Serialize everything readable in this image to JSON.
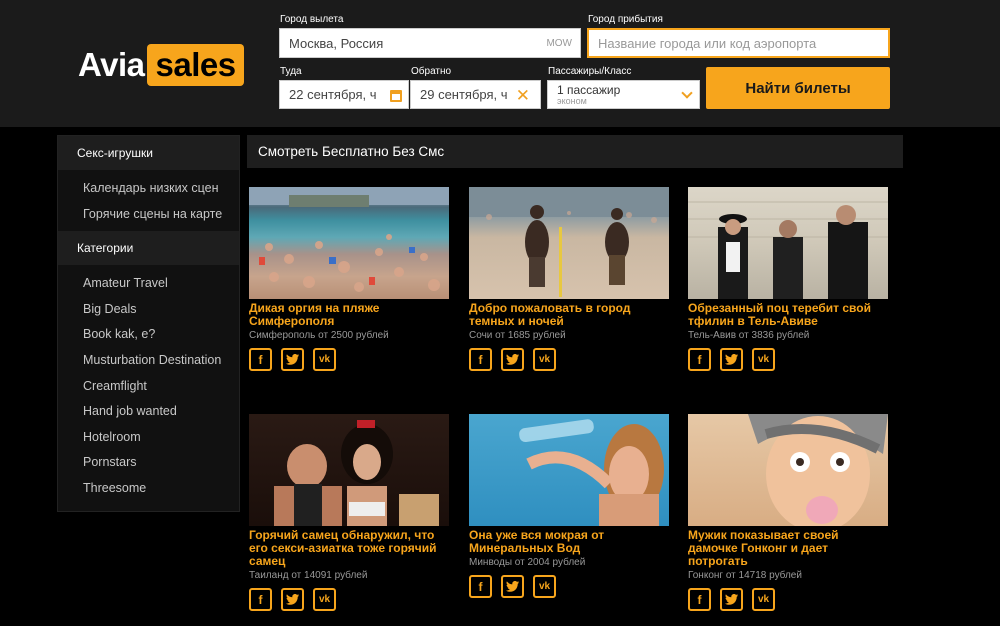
{
  "logo": {
    "part1": "Avia",
    "part2": "sales"
  },
  "search": {
    "origin_label": "Город вылета",
    "origin_value": "Москва, Россия",
    "origin_code": "MOW",
    "dest_label": "Город прибытия",
    "dest_placeholder": "Название города или код аэропорта",
    "depart_label": "Туда",
    "depart_value": "22 сентября, ч",
    "return_label": "Обратно",
    "return_value": "29 сентября, ч",
    "pass_label": "Пассажиры/Класс",
    "pass_value": "1 пассажир",
    "pass_class": "эконом",
    "button": "Найти билеты"
  },
  "sidebar": {
    "section1_title": "Секс-игрушки",
    "section1_items": [
      "Календарь низких сцен",
      "Горячие сцены на карте"
    ],
    "section2_title": "Категории",
    "section2_items": [
      "Amateur Travel",
      "Big Deals",
      "Book kak, e?",
      "Musturbation Destination",
      "Creamflight",
      "Hand job wanted",
      "Hotelroom",
      "Pornstars",
      "Threesome"
    ]
  },
  "main": {
    "title": "Смотреть Бесплатно Без Смс",
    "cards": [
      {
        "title": "Дикая оргия на пляже Симферополя",
        "sub": "Симферополь от 2500 рублей"
      },
      {
        "title": "Добро пожаловать в город темных и ночей",
        "sub": "Сочи от 1685 рублей"
      },
      {
        "title": "Обрезанный поц теребит свой тфилин в Тель-Авиве",
        "sub": "Тель-Авив от 3836 рублей"
      },
      {
        "title": "Горячий самец обнаружил, что его секси-азиатка тоже горячий самец",
        "sub": "Таиланд от 14091 рублей"
      },
      {
        "title": "Она уже вся мокрая от Минеральных Вод",
        "sub": "Минводы от 2004 рублей"
      },
      {
        "title": "Мужик показывает своей дамочке Гонконг и дает потрогать",
        "sub": "Гонконг от 14718 рублей"
      }
    ],
    "share_icons": [
      "facebook-icon",
      "twitter-icon",
      "vk-icon"
    ]
  },
  "colors": {
    "accent": "#f7a51c",
    "header_bg": "#1b1b1b",
    "page_bg": "#000000"
  }
}
